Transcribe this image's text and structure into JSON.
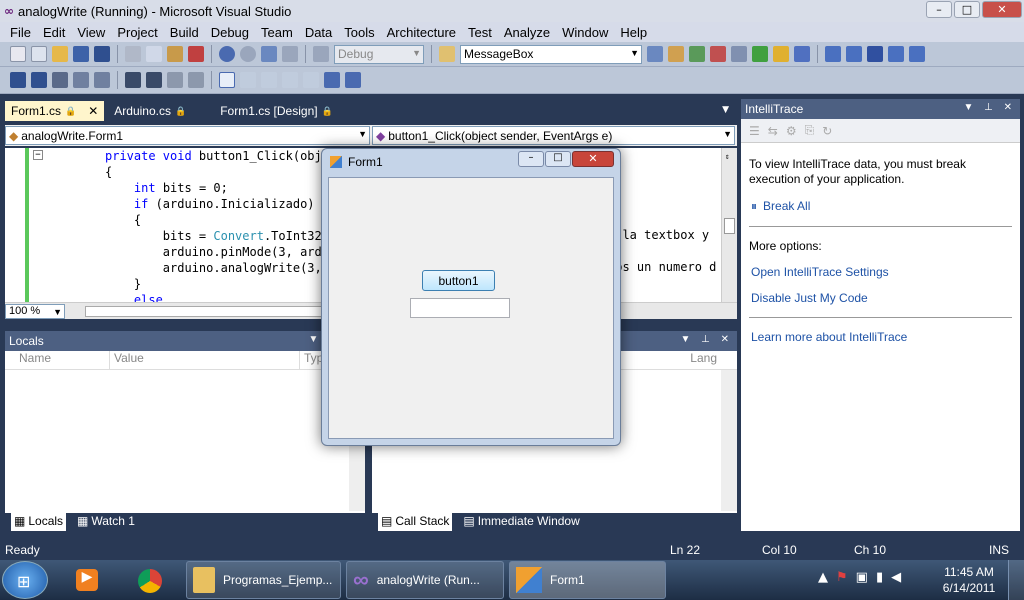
{
  "window": {
    "title": "analogWrite (Running) - Microsoft Visual Studio",
    "min": "–",
    "max": "□",
    "close": "✕"
  },
  "menu": [
    "File",
    "Edit",
    "View",
    "Project",
    "Build",
    "Debug",
    "Team",
    "Data",
    "Tools",
    "Architecture",
    "Test",
    "Analyze",
    "Window",
    "Help"
  ],
  "toolbar": {
    "config_combo": "Debug",
    "find_combo": "MessageBox"
  },
  "doc_tabs": [
    {
      "label": "Form1.cs",
      "active": true
    },
    {
      "label": "Arduino.cs",
      "active": false
    },
    {
      "label": "Form1.cs [Design]",
      "active": false
    }
  ],
  "editor": {
    "class_combo": "analogWrite.Form1",
    "member_combo": "button1_Click(object sender, EventArgs e)",
    "zoom": "100 %",
    "lines": [
      {
        "indent": "",
        "parts": [
          [
            "kw",
            "private void"
          ],
          [
            "",
            " button1_Click(objec"
          ]
        ]
      },
      {
        "indent": "",
        "parts": [
          [
            "",
            "{"
          ]
        ]
      },
      {
        "indent": "    ",
        "parts": [
          [
            "kw",
            "int"
          ],
          [
            "",
            " bits = 0;"
          ]
        ]
      },
      {
        "indent": "    ",
        "parts": [
          [
            "kw",
            "if"
          ],
          [
            "",
            " (arduino.Inicializado)"
          ]
        ]
      },
      {
        "indent": "    ",
        "parts": [
          [
            "",
            "{"
          ]
        ]
      },
      {
        "indent": "        ",
        "parts": [
          [
            "",
            "bits = "
          ],
          [
            "ty",
            "Convert"
          ],
          [
            "",
            ".ToInt32(t"
          ]
        ]
      },
      {
        "indent": "        ",
        "parts": [
          [
            "",
            "arduino.pinMode(3, ardui"
          ]
        ]
      },
      {
        "indent": "        ",
        "parts": [
          [
            "",
            "arduino.analogWrite(3,bi"
          ]
        ]
      },
      {
        "indent": "    ",
        "parts": [
          [
            "",
            "}"
          ]
        ]
      },
      {
        "indent": "    ",
        "parts": [
          [
            "kw",
            "else"
          ]
        ]
      }
    ],
    "overflow_right": [
      "e la textbox y",
      "mos un numero d"
    ]
  },
  "locals": {
    "title": "Locals",
    "columns": [
      "Name",
      "Value",
      "Typ"
    ]
  },
  "callstack": {
    "column": "Lang"
  },
  "bottom_tabs_left": [
    "Locals",
    "Watch 1"
  ],
  "bottom_tabs_right": [
    "Call Stack",
    "Immediate Window"
  ],
  "intellitrace": {
    "title": "IntelliTrace",
    "message": "To view IntelliTrace data, you must break execution of your application.",
    "break_all": "Break All",
    "more_options": "More options:",
    "links": [
      "Open IntelliTrace Settings",
      "Disable Just My Code"
    ],
    "learn_more": "Learn more about IntelliTrace"
  },
  "form1": {
    "title": "Form1",
    "button_label": "button1",
    "textbox_value": ""
  },
  "status": {
    "left": "Ready",
    "ln": "Ln 22",
    "col": "Col 10",
    "ch": "Ch 10",
    "ins": "INS"
  },
  "taskbar": {
    "items": [
      "Programas_Ejemp...",
      "analogWrite (Run...",
      "Form1"
    ],
    "time": "11:45 AM",
    "date": "6/14/2011"
  }
}
